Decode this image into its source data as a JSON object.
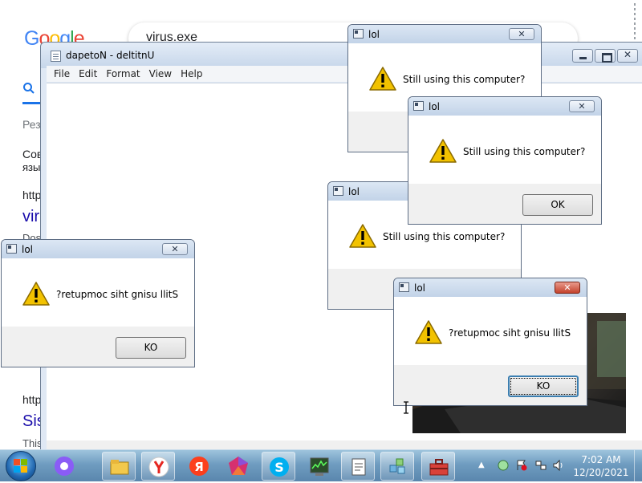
{
  "browser": {
    "search_query": "virus.exe",
    "tab_results_label": "Рез",
    "result1_snippet_line1": "Сов",
    "result1_snippet_line2": "язы",
    "result1_url": "http",
    "result1_title": "vir",
    "result1_desc": "Dos",
    "result2_url": "http",
    "result2_title": "Sis",
    "result2_desc": "This"
  },
  "notepad": {
    "title": "dapetoN - deltitnU",
    "menu": [
      "File",
      "Edit",
      "Format",
      "View",
      "Help"
    ]
  },
  "dialogs": [
    {
      "title": "lol",
      "message": "Still using this computer?",
      "button": ""
    },
    {
      "title": "lol",
      "message": "Still using this computer?",
      "button": "OK"
    },
    {
      "title": "lol",
      "message": "Still using this computer?",
      "button": ""
    },
    {
      "title": "lol",
      "message": "?retupmoc siht gnisu llitS",
      "button": "KO"
    },
    {
      "title": "lol",
      "message": "?retupmoc siht gnisu llitS",
      "button": "KO"
    }
  ],
  "taskbar": {
    "pinned_apps": [
      "alice-icon",
      "yandex-browser-icon",
      "yandex-icon",
      "polygon-icon",
      "skype-icon",
      "task-manager-icon",
      "notepad-app-icon",
      "blocks-icon",
      "toolbox-icon"
    ],
    "time": "7:02 AM",
    "date": "12/20/2021"
  },
  "colors": {
    "taskbar": "#6f9cc0",
    "link": "#1a0dab",
    "close_active": "#c4432d"
  }
}
